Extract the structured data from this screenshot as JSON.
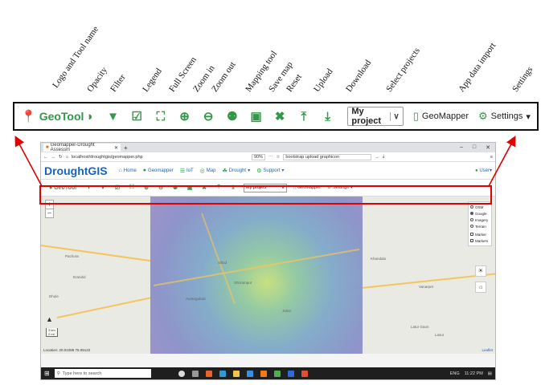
{
  "annotations": [
    {
      "text": "Logo and Tool name"
    },
    {
      "text": "Opacity"
    },
    {
      "text": "Filter"
    },
    {
      "text": "Legend"
    },
    {
      "text": "Full Screen"
    },
    {
      "text": "Zoom in"
    },
    {
      "text": "Zoom out"
    },
    {
      "text": "Mapping tool"
    },
    {
      "text": "Save map"
    },
    {
      "text": "Reset"
    },
    {
      "text": "Upload"
    },
    {
      "text": "Download"
    },
    {
      "text": "Select projects"
    },
    {
      "text": "App data import"
    },
    {
      "text": "Settings"
    }
  ],
  "toolbar": {
    "logo_icon": "map-pin-icon",
    "tool_name": "GeoTool",
    "project_select": "My project",
    "geomapper_label": "GeoMapper",
    "settings_label": "Settings",
    "accent": "#2e9a45"
  },
  "browser": {
    "tab_title": "Geomapper-Drought Assessm",
    "url": "localhost/droughtgis/geomapper.php",
    "zoom": "90%",
    "search": "bootstrap upload graphicon"
  },
  "app_nav": {
    "brand": "DroughtGIS",
    "items": [
      "Home",
      "Geomapper",
      "IoT",
      "Map",
      "Drought",
      "Support"
    ],
    "user": "User"
  },
  "map": {
    "layers": [
      "OSM",
      "Google",
      "Imagery",
      "Terrain"
    ],
    "selected_layer": "Google",
    "checkboxes": [
      "Marker",
      "Markers"
    ],
    "scale": [
      "3 km",
      "2 mi"
    ],
    "location": "Location: 20.01085  75.05122",
    "attribution": "Leaflet",
    "cities": [
      "Pachora",
      "Erandol",
      "Dhule",
      "Sillod",
      "Aurangabad",
      "Shrirampur",
      "Jalna",
      "Khandala",
      "Vanarpet",
      "Latur Gaon",
      "Lasur"
    ]
  },
  "taskbar": {
    "search_placeholder": "Type here to search",
    "time": "11:22 PM",
    "lang": "ENG"
  }
}
